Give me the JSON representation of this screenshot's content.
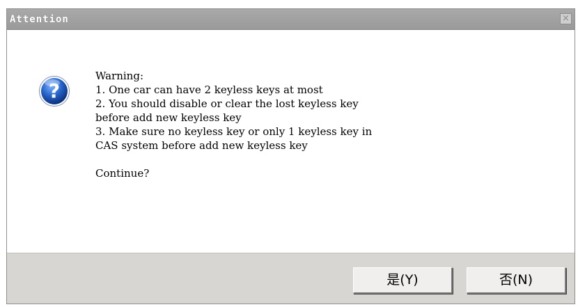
{
  "dialog": {
    "title": "Attention",
    "close_glyph": "×",
    "icon": "question-icon",
    "message_lines": [
      "Warning:",
      "1. One car can have 2 keyless keys at most",
      "2. You should disable or clear the lost keyless key",
      "before add new keyless key",
      "3. Make sure no keyless key or only 1 keyless key in",
      "CAS system before add new keyless key",
      "",
      "Continue?"
    ],
    "buttons": {
      "yes_label": "是(Y)",
      "no_label": "否(N)"
    }
  },
  "colors": {
    "titlebar": "#a1a1a1",
    "footer": "#d8d6d3",
    "icon_blue": "#1f5fbf"
  }
}
